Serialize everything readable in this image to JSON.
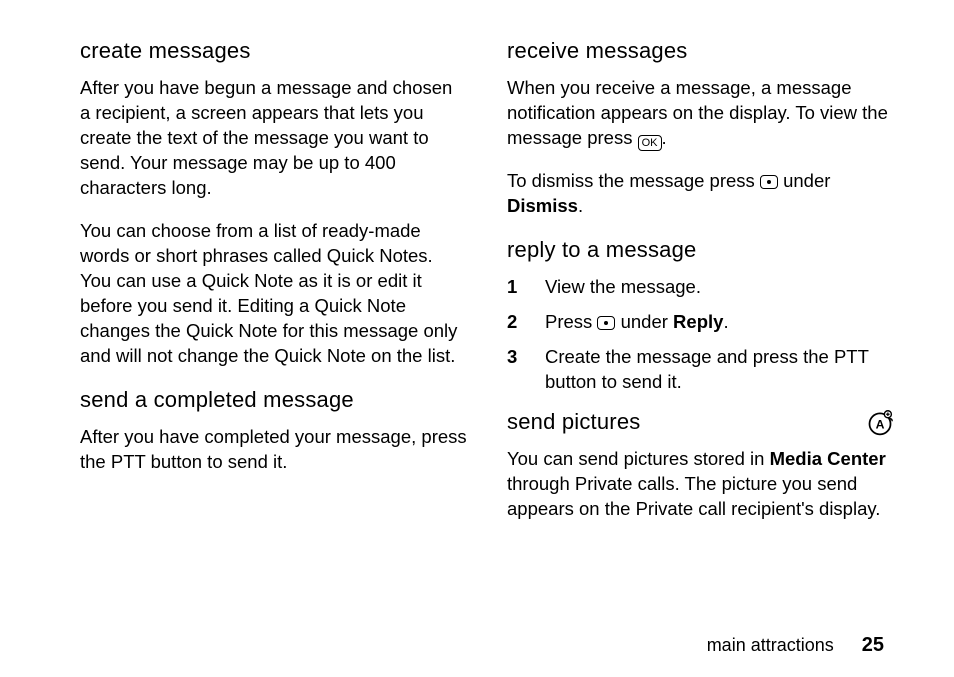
{
  "left": {
    "h_create": "create messages",
    "create_p1": "After you have begun a message and chosen a recipient, a screen appears that lets you create the text of the message you want to send. Your message may be up to 400 characters long.",
    "create_p2": "You can choose from a list of ready-made words or short phrases called Quick Notes. You can use a Quick Note as it is or edit it before you send it. Editing a Quick Note changes the Quick Note for this message only and will not change the Quick Note on the list.",
    "h_send": "send a completed message",
    "send_p1": "After you have completed your message, press the PTT button to send it."
  },
  "right": {
    "h_receive": "receive messages",
    "receive_p1_a": "When you receive a message, a message notification appears on the display. To view the message press ",
    "receive_p1_key": "OK",
    "receive_p1_b": ".",
    "receive_p2_a": "To dismiss the message press ",
    "receive_p2_b": " under ",
    "receive_p2_bold": "Dismiss",
    "receive_p2_c": ".",
    "h_reply": "reply to a message",
    "reply_1": "View the message.",
    "reply_2_a": "Press ",
    "reply_2_b": " under ",
    "reply_2_bold": "Reply",
    "reply_2_c": ".",
    "reply_3": "Create the message and press the PTT button to send it.",
    "h_pictures": "send pictures",
    "pictures_p1_a": "You can send pictures stored in ",
    "pictures_p1_bold": "Media Center",
    "pictures_p1_b": " through Private calls. The picture you send appears on the Private call recipient's display."
  },
  "footer": {
    "section": "main attractions",
    "page": "25"
  }
}
